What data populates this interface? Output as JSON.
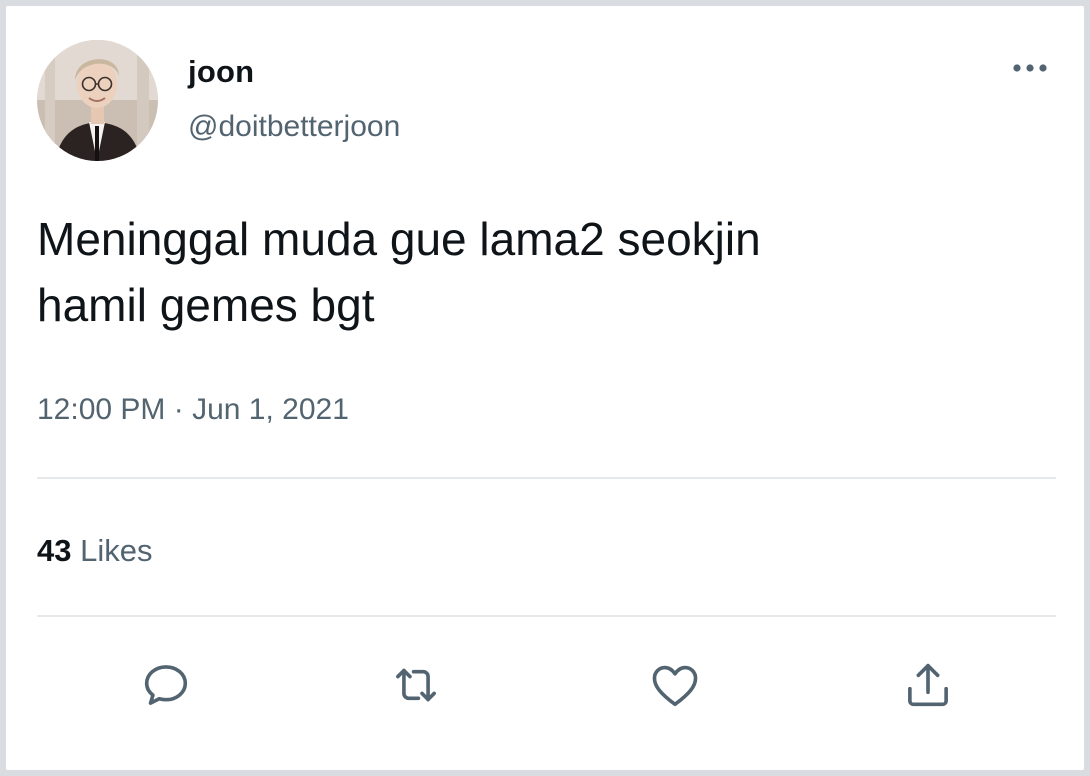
{
  "user": {
    "display_name": "joon",
    "handle": "@doitbetterjoon",
    "avatar_icon": "profile-photo"
  },
  "tweet": {
    "text_line1": "Meninggal muda gue lama2 seokjin",
    "text_line2": "hamil gemes bgt",
    "time": "12:00 PM",
    "separator": " · ",
    "date": "Jun 1, 2021"
  },
  "stats": {
    "likes_count": "43",
    "likes_label": " Likes"
  },
  "actions": [
    {
      "name": "reply",
      "icon": "comment-icon"
    },
    {
      "name": "retweet",
      "icon": "retweet-icon"
    },
    {
      "name": "like",
      "icon": "heart-icon"
    },
    {
      "name": "share",
      "icon": "share-icon"
    }
  ],
  "colors": {
    "text_primary": "#0f1419",
    "text_secondary": "#536471",
    "icon": "#536471",
    "divider": "#e6e9ec",
    "background": "#ffffff"
  }
}
